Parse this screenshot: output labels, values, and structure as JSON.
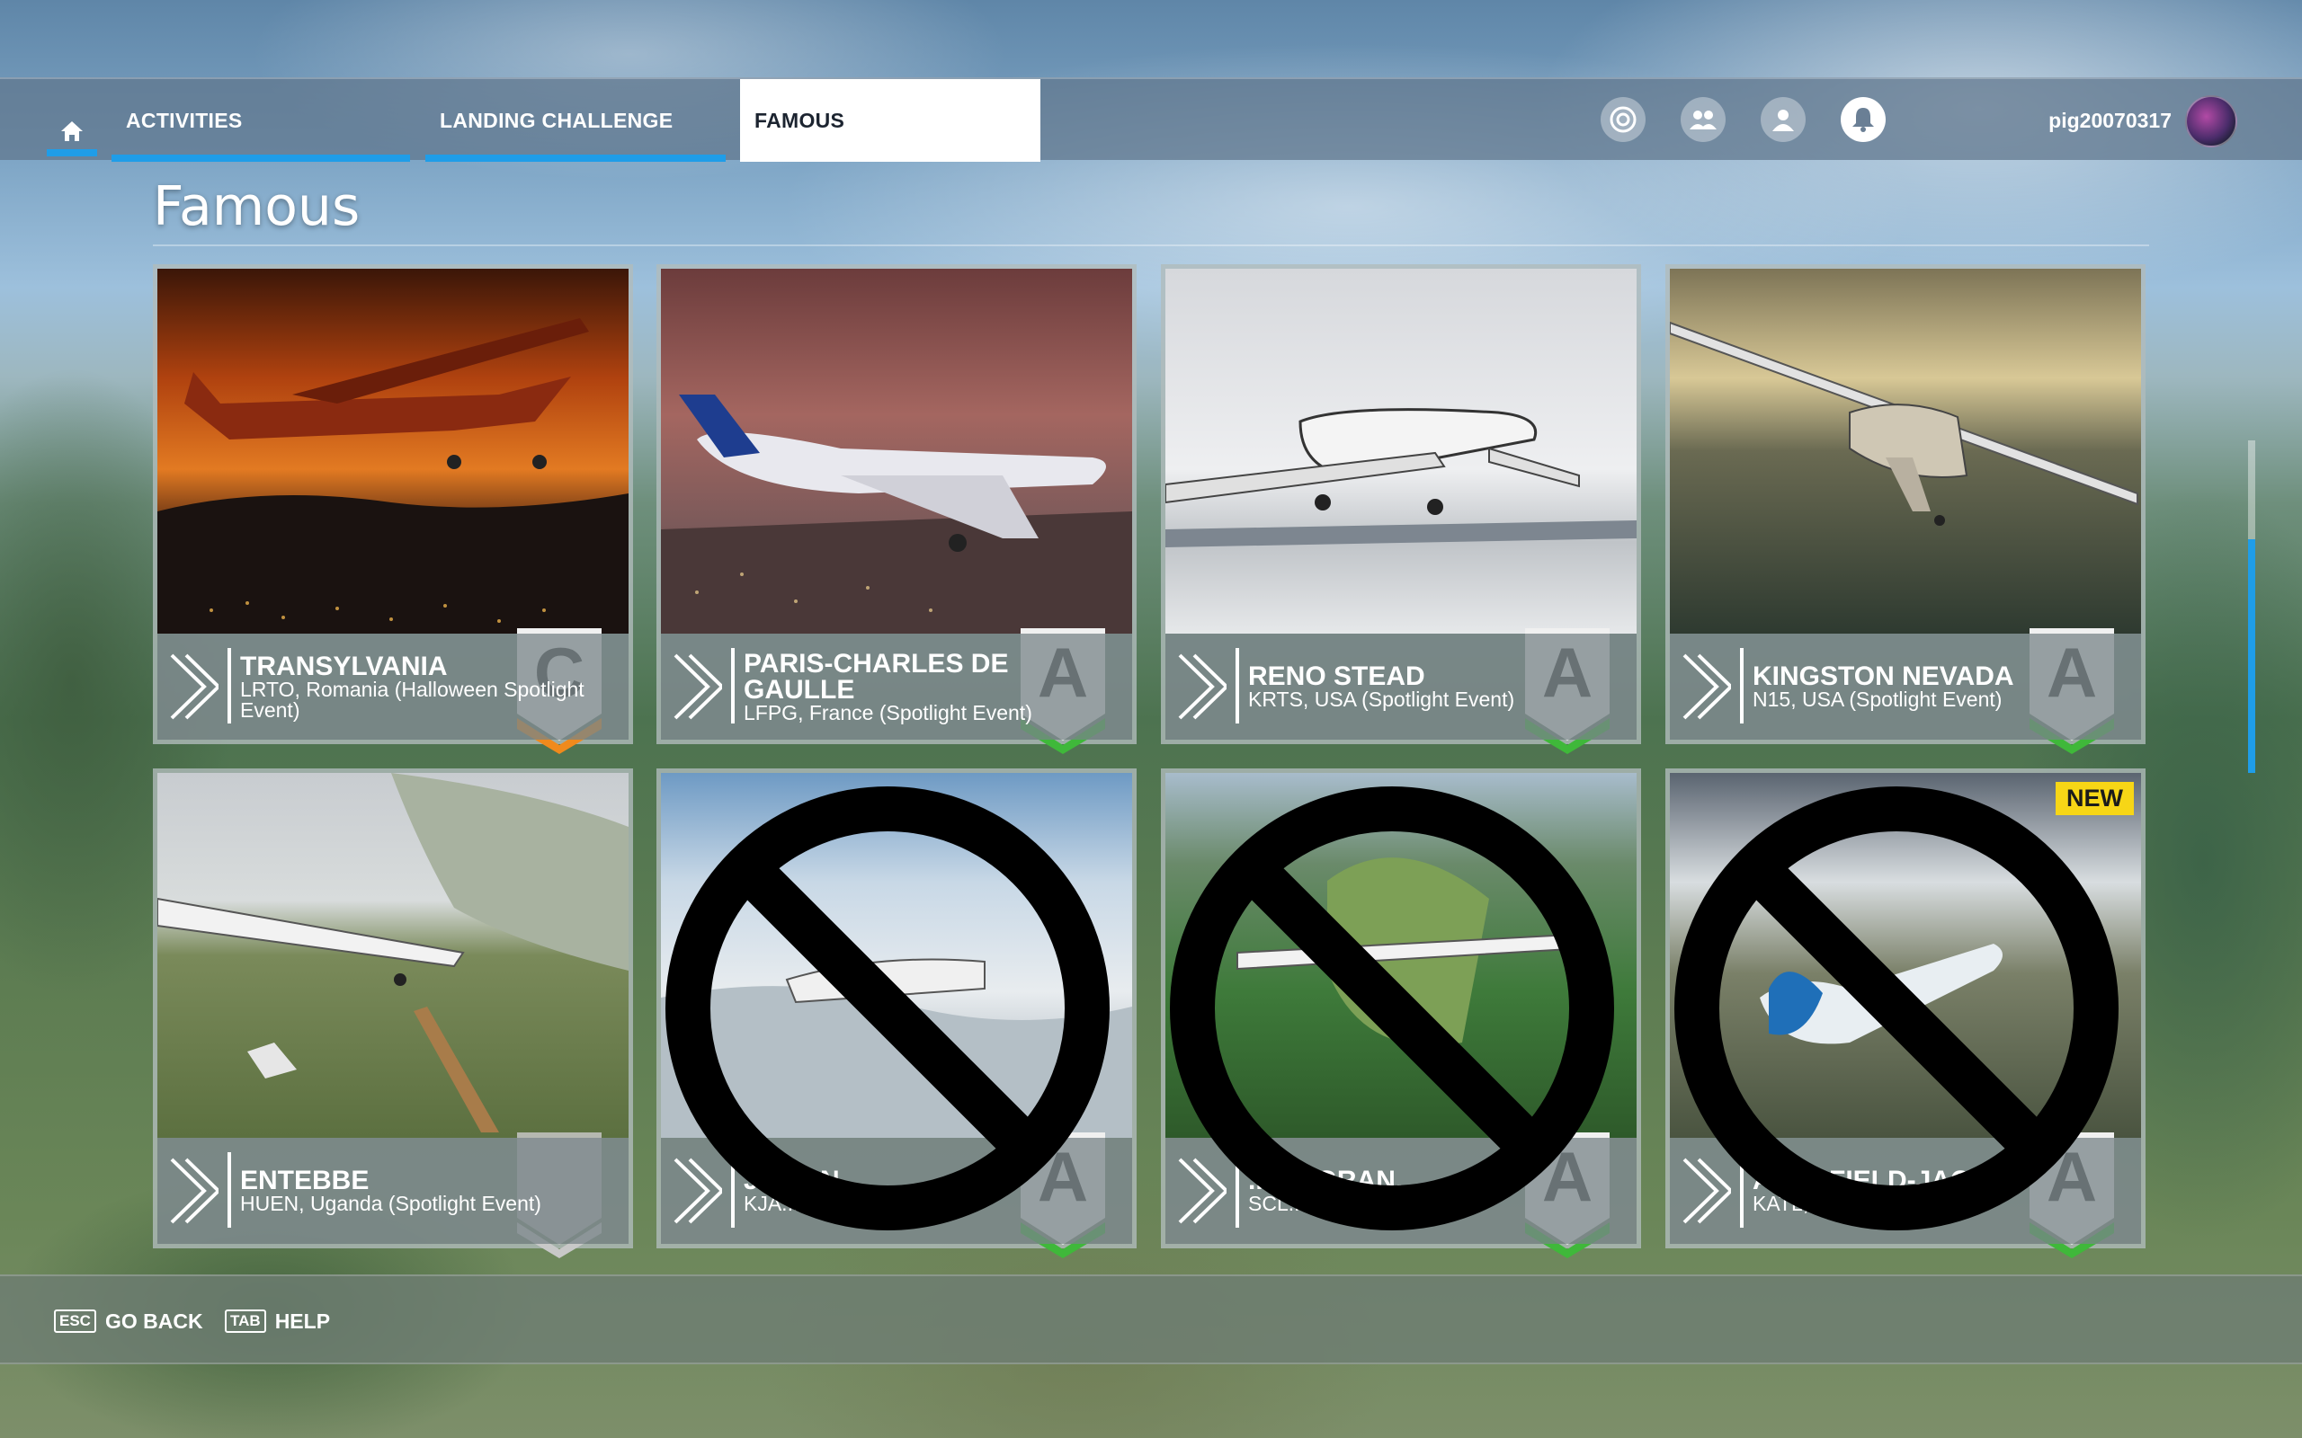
{
  "nav": {
    "tabs": [
      {
        "label": "ACTIVITIES"
      },
      {
        "label": "LANDING CHALLENGE"
      },
      {
        "label": "FAMOUS"
      }
    ],
    "icons": [
      "achievement-icon",
      "friends-icon",
      "profile-icon",
      "notification-bell-icon"
    ],
    "username": "pig20070317"
  },
  "page": {
    "title": "Famous"
  },
  "cards": [
    {
      "title": "TRANSYLVANIA",
      "subtitle": "LRTO, Romania (Halloween Spotlight Event)",
      "grade": "C",
      "grade_color": "#f08a1c",
      "new": "",
      "blocked": false
    },
    {
      "title": "PARIS-CHARLES DE GAULLE",
      "subtitle": "LFPG, France (Spotlight Event)",
      "grade": "A",
      "grade_color": "#3fb83a",
      "new": "",
      "blocked": false
    },
    {
      "title": "RENO STEAD",
      "subtitle": "KRTS, USA (Spotlight Event)",
      "grade": "A",
      "grade_color": "#3fb83a",
      "new": "",
      "blocked": false
    },
    {
      "title": "KINGSTON NEVADA",
      "subtitle": "N15, USA (Spotlight Event)",
      "grade": "A",
      "grade_color": "#3fb83a",
      "new": "",
      "blocked": false
    },
    {
      "title": "ENTEBBE",
      "subtitle": "HUEN, Uganda (Spotlight Event)",
      "grade": "",
      "grade_color": "#c8c8c8",
      "new": "",
      "blocked": false
    },
    {
      "title": "J...SON",
      "subtitle": "KJA...",
      "grade": "A",
      "grade_color": "#3fb83a",
      "new": "",
      "blocked": true
    },
    {
      "title": "...DA GRAN...",
      "subtitle": "SCL...",
      "grade": "A",
      "grade_color": "#3fb83a",
      "new": "",
      "blocked": true
    },
    {
      "title": "A...TSFIELD-JAC...",
      "subtitle": "KATL, At...",
      "grade": "A",
      "grade_color": "#3fb83a",
      "new": "NEW",
      "blocked": true
    }
  ],
  "footer": {
    "back_key": "ESC",
    "back_label": "GO BACK",
    "help_key": "TAB",
    "help_label": "HELP"
  },
  "colors": {
    "accent": "#1f9de8",
    "new_badge": "#f7d616"
  }
}
